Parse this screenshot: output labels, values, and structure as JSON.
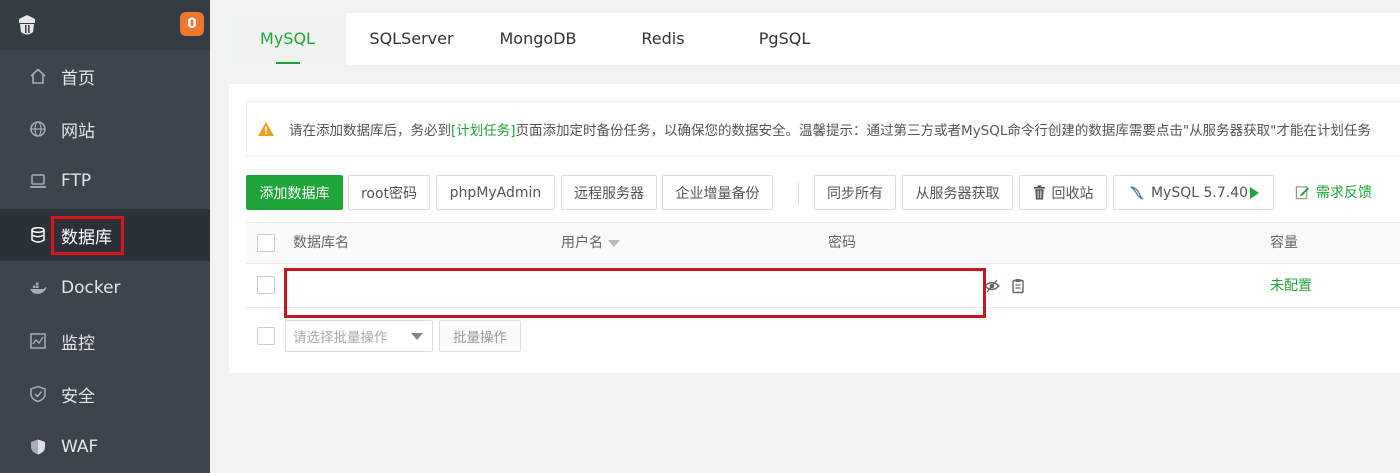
{
  "sidebar": {
    "badge": "0",
    "items": [
      {
        "label": "首页",
        "icon": "home-icon"
      },
      {
        "label": "网站",
        "icon": "globe-icon"
      },
      {
        "label": "FTP",
        "icon": "ftp-icon"
      },
      {
        "label": "数据库",
        "icon": "database-icon"
      },
      {
        "label": "Docker",
        "icon": "docker-icon"
      },
      {
        "label": "监控",
        "icon": "monitor-icon"
      },
      {
        "label": "安全",
        "icon": "shield-icon"
      },
      {
        "label": "WAF",
        "icon": "waf-shield-icon"
      }
    ],
    "active_index": 3
  },
  "tabs": [
    "MySQL",
    "SQLServer",
    "MongoDB",
    "Redis",
    "PgSQL"
  ],
  "notice": {
    "before": "请在添加数据库后，务必到",
    "link": "[计划任务]",
    "after": "页面添加定时备份任务，以确保您的数据安全。温馨提示：通过第三方或者MySQL命令行创建的数据库需要点击\"从服务器获取\"才能在计划任务"
  },
  "toolbar": {
    "add_db": "添加数据库",
    "root_password": "root密码",
    "phpmyadmin": "phpMyAdmin",
    "remote_server": "远程服务器",
    "enterprise_backup": "企业增量备份",
    "sync_all": "同步所有",
    "fetch_from_server": "从服务器获取",
    "recycle_bin": "回收站",
    "mysql_version": "MySQL 5.7.40",
    "feedback": "需求反馈"
  },
  "table": {
    "columns": [
      "数据库名",
      "用户名",
      "密码",
      "容量"
    ],
    "rows": [
      {
        "name": "",
        "user": "",
        "password": "",
        "capacity_status": "未配置"
      }
    ]
  },
  "batch": {
    "placeholder": "请选择批量操作",
    "button": "批量操作"
  },
  "colors": {
    "accent": "#20a53a",
    "sidebar_bg": "#3c444d",
    "badge": "#f0772f",
    "highlight": "#c8161d"
  }
}
